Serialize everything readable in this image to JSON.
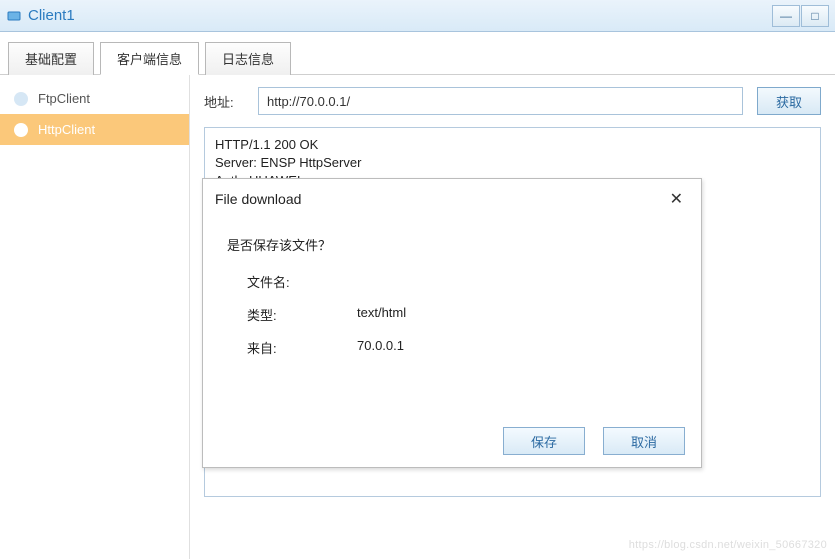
{
  "window": {
    "title": "Client1"
  },
  "titlebar_controls": {
    "minimize": "—",
    "maximize": "□"
  },
  "tabs": [
    {
      "label": "基础配置",
      "active": false
    },
    {
      "label": "客户端信息",
      "active": true
    },
    {
      "label": "日志信息",
      "active": false
    }
  ],
  "sidebar": {
    "items": [
      {
        "label": "FtpClient",
        "active": false
      },
      {
        "label": "HttpClient",
        "active": true
      }
    ]
  },
  "address": {
    "label": "地址:",
    "value": "http://70.0.0.1/",
    "fetch_label": "获取"
  },
  "response": {
    "line1": "HTTP/1.1 200 OK",
    "line2": "Server: ENSP HttpServer",
    "line3": "Auth: HUAWEI"
  },
  "dialog": {
    "title": "File download",
    "question": "是否保存该文件？",
    "filename_label": "文件名:",
    "filename_value": "",
    "type_label": "类型:",
    "type_value": "text/html",
    "from_label": "来自:",
    "from_value": "70.0.0.1",
    "save_label": "保存",
    "cancel_label": "取消"
  },
  "watermark": "https://blog.csdn.net/weixin_50667320"
}
